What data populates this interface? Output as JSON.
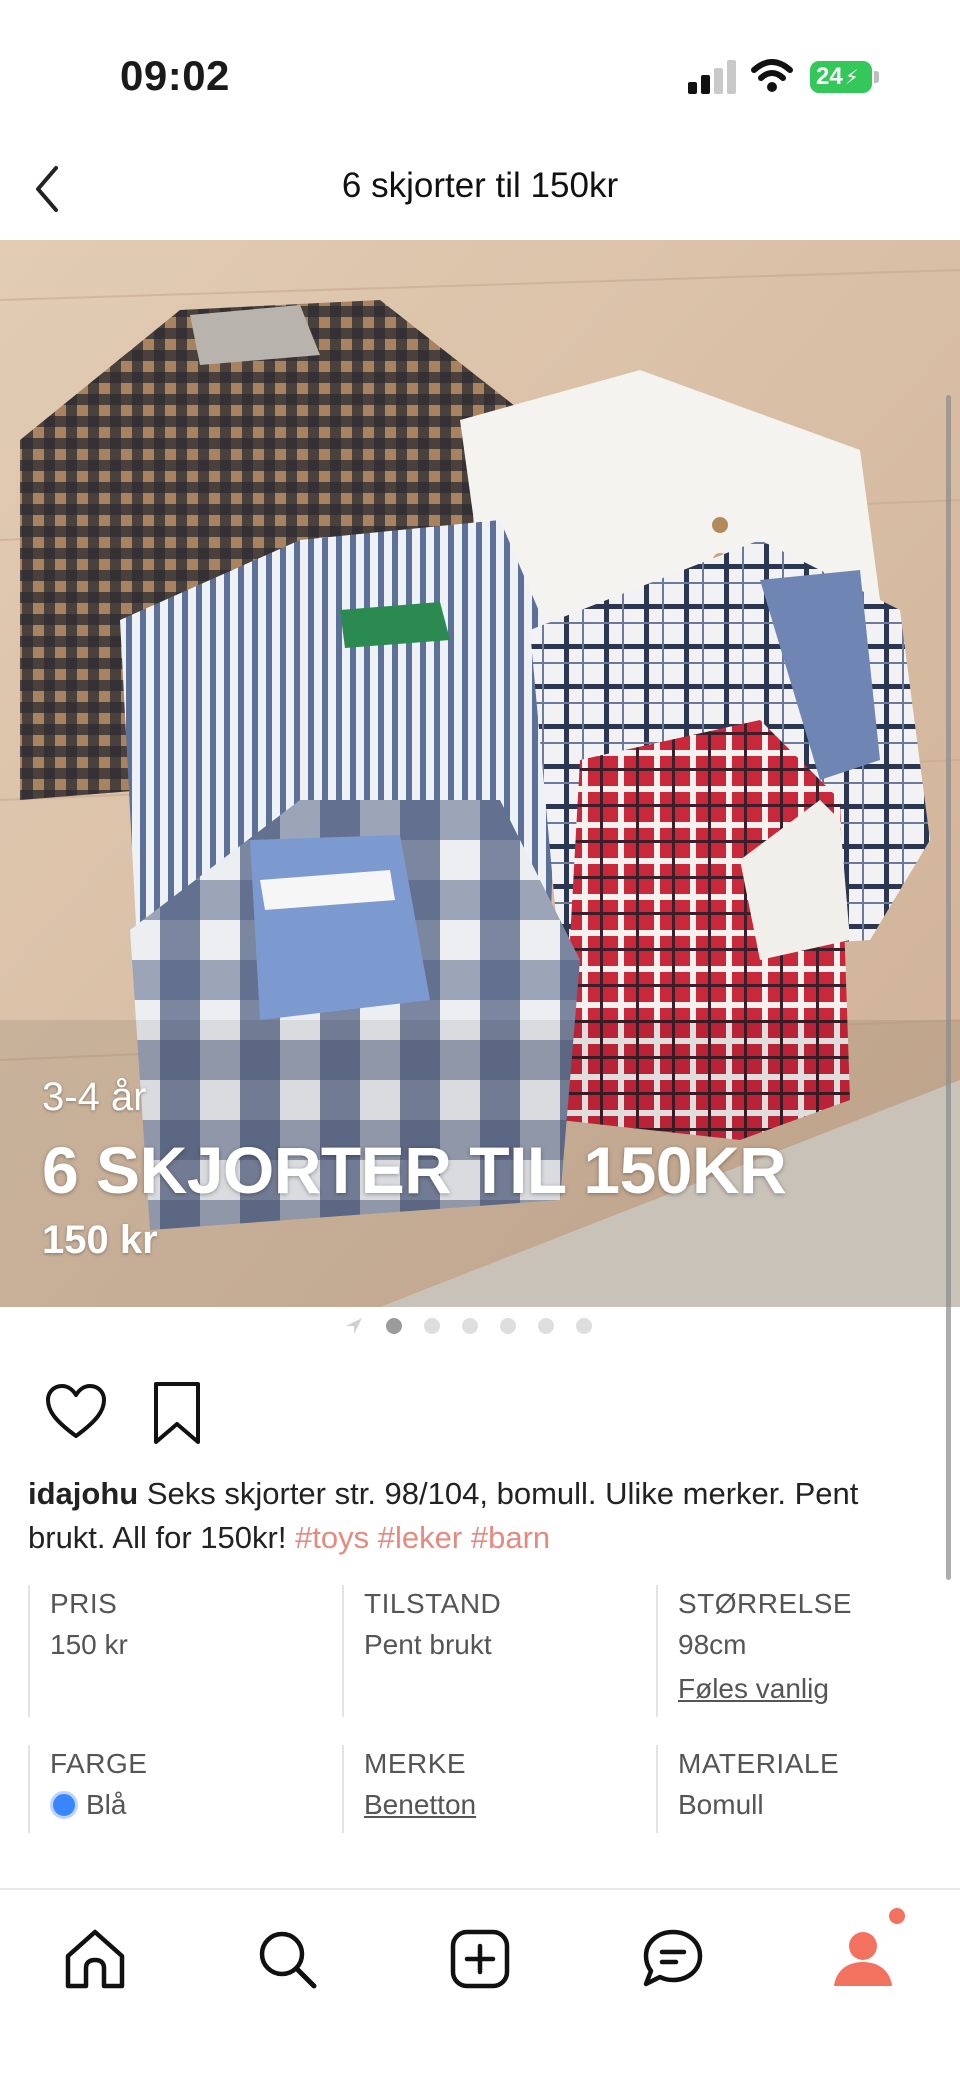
{
  "status_bar": {
    "time": "09:02",
    "battery": "24"
  },
  "header": {
    "title": "6 skjorter til 150kr"
  },
  "photo": {
    "overlay_size": "3-4 år",
    "overlay_title": "6 SKJORTER TIL 150KR",
    "overlay_price": "150 kr"
  },
  "carousel": {
    "count": 6,
    "active": 0
  },
  "caption": {
    "username": "idajohu",
    "text": " Seks skjorter str. 98/104, bomull. Ulike merker. Pent brukt. All for 150kr! ",
    "tags": [
      "#toys",
      "#leker",
      "#barn"
    ]
  },
  "details": {
    "price_label": "PRIS",
    "price_value": "150 kr",
    "condition_label": "TILSTAND",
    "condition_value": "Pent brukt",
    "size_label": "STØRRELSE",
    "size_value": "98cm",
    "size_fit_link": "Føles vanlig",
    "color_label": "FARGE",
    "color_value": "Blå",
    "color_hex": "#3a86ff",
    "brand_label": "MERKE",
    "brand_value": "Benetton",
    "material_label": "MATERIALE",
    "material_value": "Bomull"
  },
  "tabbar": {
    "icons": [
      "home-icon",
      "search-icon",
      "add-icon",
      "messages-icon",
      "profile-icon"
    ],
    "accent": "#f2715f"
  }
}
